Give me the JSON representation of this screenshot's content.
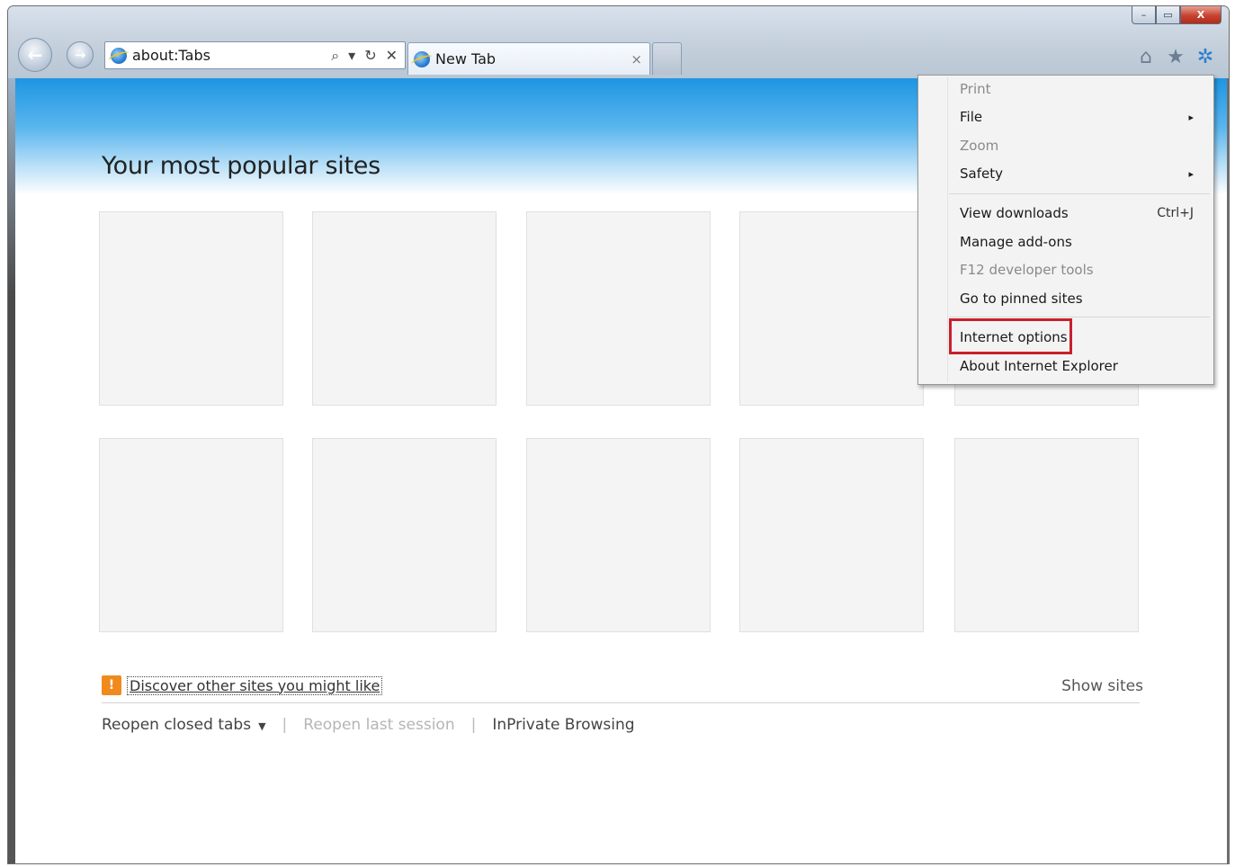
{
  "window": {
    "controls": {
      "minimize": "–",
      "maximize": "▭",
      "close": "X"
    }
  },
  "nav": {
    "back_icon": "←",
    "forward_icon": "→"
  },
  "addressbar": {
    "url": "about:Tabs",
    "search_icon": "⌕",
    "dropdown_icon": "▾",
    "refresh_icon": "↻",
    "stop_icon": "✕"
  },
  "tab": {
    "label": "New Tab",
    "close": "×"
  },
  "toolbar": {
    "home_icon": "⌂",
    "favorites_icon": "★",
    "tools_icon": "✲"
  },
  "page": {
    "title": "Your most popular sites",
    "discover_icon": "!",
    "discover_link": "Discover other sites you might like",
    "show_sites": "Show sites",
    "reopen_closed_tabs": "Reopen closed tabs",
    "reopen_caret": "▼",
    "separator": "|",
    "reopen_last_session": "Reopen last session",
    "inprivate": "InPrivate Browsing"
  },
  "menu": {
    "items": [
      {
        "label": "Print",
        "disabled": true
      },
      {
        "label": "File",
        "submenu": "▸"
      },
      {
        "label": "Zoom",
        "disabled": true
      },
      {
        "label": "Safety",
        "submenu": "▸"
      },
      {
        "label": "View downloads",
        "shortcut": "Ctrl+J"
      },
      {
        "label": "Manage add-ons"
      },
      {
        "label": "F12 developer tools",
        "disabled": true
      },
      {
        "label": "Go to pinned sites"
      },
      {
        "label": "Internet options",
        "highlighted": true
      },
      {
        "label": "About Internet Explorer"
      }
    ],
    "highlight_color": "#c8202c"
  }
}
